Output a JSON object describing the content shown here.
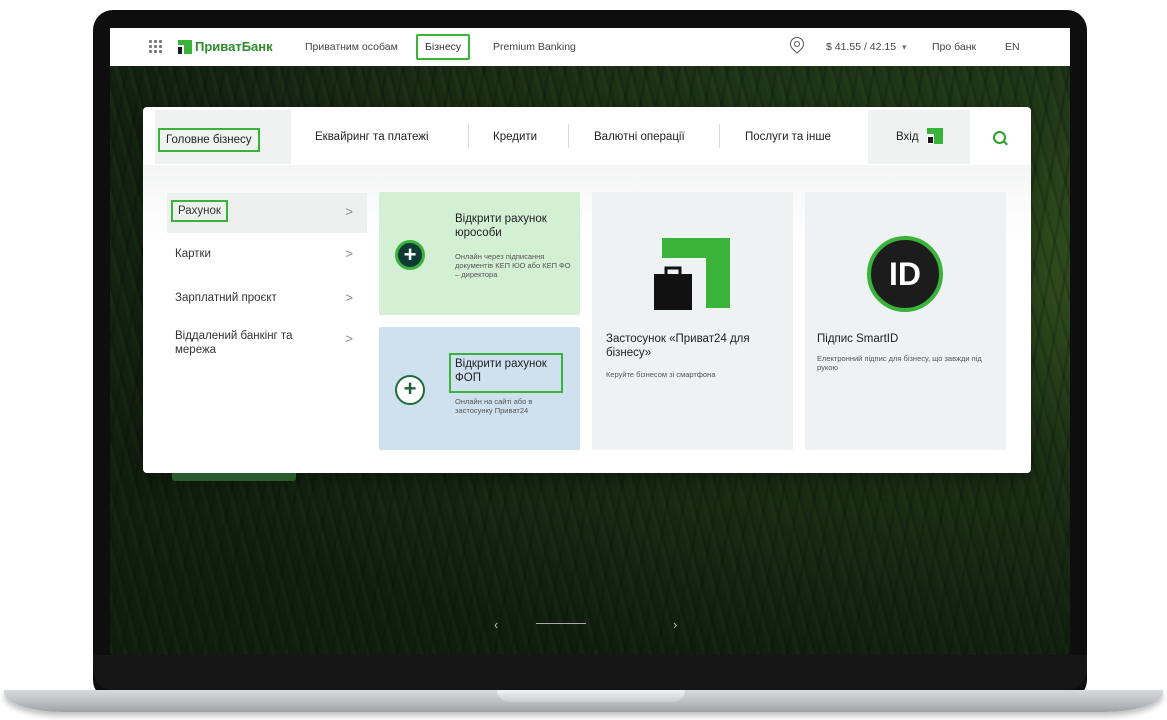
{
  "topnav": {
    "logo_text": "ПриватБанк",
    "links": [
      "Приватним особам",
      "Бізнесу",
      "Premium Banking"
    ],
    "currency": "$ 41.55 / 42.15",
    "currency_caret": "▾",
    "about": "Про банк",
    "lang": "EN"
  },
  "subnav": {
    "items": [
      "Головне бізнесу",
      "Еквайринг та платежі",
      "Кредити",
      "Валютні операції",
      "Послуги та інше"
    ],
    "login": "Вхід"
  },
  "leftmenu": {
    "items": [
      {
        "label": "Рахунок",
        "chevron": ">"
      },
      {
        "label": "Картки",
        "chevron": ">"
      },
      {
        "label": "Зарплатний проєкт",
        "chevron": ">"
      },
      {
        "label": "Віддалений банкінг та мережа",
        "chevron": ">"
      }
    ]
  },
  "cards": {
    "open_legal": {
      "title": "Відкрити рахунок юрособи",
      "sub": "Онлайн через підписання документів КЕП ЮО або КЕП ФО – директора"
    },
    "open_fop": {
      "title": "Відкрити рахунок ФОП",
      "sub": "Онлайн на сайті або в застосунку Приват24"
    },
    "app": {
      "title": "Застосунок «Приват24 для бізнесу»",
      "sub": "Керуйте бізнесом зі смартфона"
    },
    "smartid": {
      "title": "Підпис SmartID",
      "sub": "Електронний підпис для бізнесу, що завжди під рукою",
      "icon_text": "ID"
    }
  },
  "slider": {
    "prev": "‹",
    "next": "›"
  },
  "colors": {
    "brand_green": "#3ab33a",
    "dark_green": "#0f3b34"
  }
}
